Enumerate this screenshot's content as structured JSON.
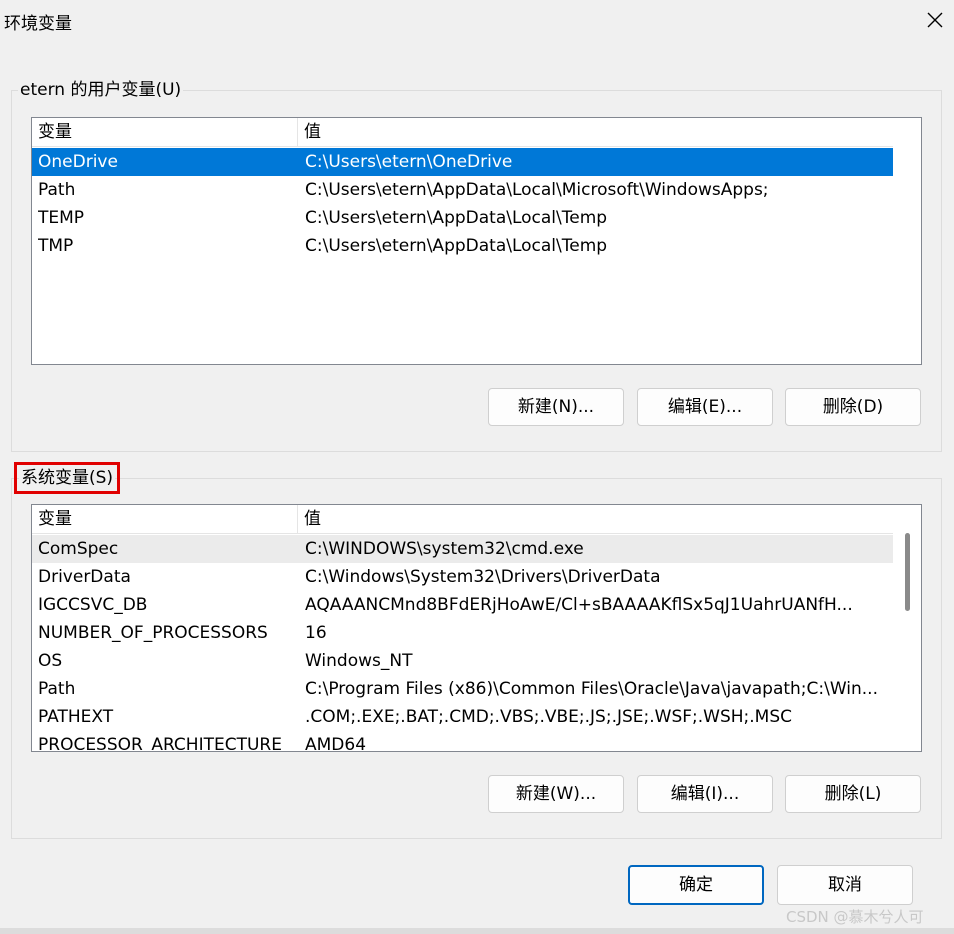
{
  "window": {
    "title": "环境变量"
  },
  "user_vars": {
    "label": "etern 的用户变量(U)",
    "columns": [
      "变量",
      "值"
    ],
    "rows": [
      {
        "name": "OneDrive",
        "value": "C:\\Users\\etern\\OneDrive",
        "selected": true
      },
      {
        "name": "Path",
        "value": "C:\\Users\\etern\\AppData\\Local\\Microsoft\\WindowsApps;"
      },
      {
        "name": "TEMP",
        "value": "C:\\Users\\etern\\AppData\\Local\\Temp"
      },
      {
        "name": "TMP",
        "value": "C:\\Users\\etern\\AppData\\Local\\Temp"
      }
    ],
    "buttons": {
      "new": "新建(N)...",
      "edit": "编辑(E)...",
      "delete": "删除(D)"
    }
  },
  "system_vars": {
    "label": "系统变量(S)",
    "columns": [
      "变量",
      "值"
    ],
    "rows": [
      {
        "name": "ComSpec",
        "value": "C:\\WINDOWS\\system32\\cmd.exe",
        "hover": true
      },
      {
        "name": "DriverData",
        "value": "C:\\Windows\\System32\\Drivers\\DriverData"
      },
      {
        "name": "IGCCSVC_DB",
        "value": "AQAAANCMnd8BFdERjHoAwE/Cl+sBAAAAKflSx5qJ1UahrUANfH..."
      },
      {
        "name": "NUMBER_OF_PROCESSORS",
        "value": "16"
      },
      {
        "name": "OS",
        "value": "Windows_NT"
      },
      {
        "name": "Path",
        "value": "C:\\Program Files (x86)\\Common Files\\Oracle\\Java\\javapath;C:\\Win..."
      },
      {
        "name": "PATHEXT",
        "value": ".COM;.EXE;.BAT;.CMD;.VBS;.VBE;.JS;.JSE;.WSF;.WSH;.MSC"
      },
      {
        "name": "PROCESSOR_ARCHITECTURE",
        "value": "AMD64"
      }
    ],
    "buttons": {
      "new": "新建(W)...",
      "edit": "编辑(I)...",
      "delete": "删除(L)"
    }
  },
  "dialog_buttons": {
    "ok": "确定",
    "cancel": "取消"
  },
  "watermark": "CSDN @慕木兮人可"
}
